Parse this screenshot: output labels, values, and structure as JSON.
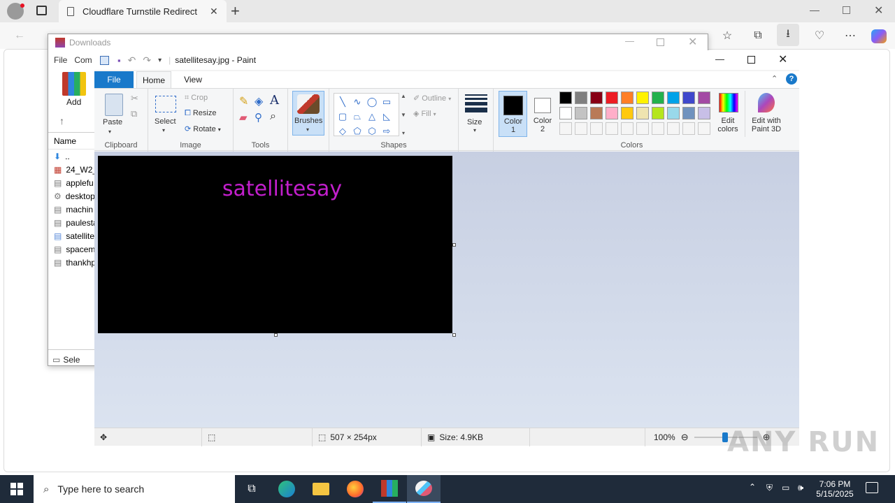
{
  "browser": {
    "tab_title": "Cloudflare Turnstile Redirect",
    "new_tab_label": "+"
  },
  "explorer": {
    "title": "Downloads",
    "menu": [
      "File",
      "Com"
    ],
    "add_label": "Add",
    "column_name": "Name",
    "files": [
      "..",
      "24_W2_I",
      "applefu",
      "desktop",
      "machin",
      "paulesta",
      "satellite",
      "spacem",
      "thankhp"
    ],
    "status": "Sele"
  },
  "paint": {
    "title": "satellitesay.jpg - Paint",
    "tabs": {
      "file": "File",
      "home": "Home",
      "view": "View"
    },
    "clipboard": {
      "paste": "Paste",
      "group": "Clipboard"
    },
    "image": {
      "select": "Select",
      "crop": "Crop",
      "resize": "Resize",
      "rotate": "Rotate",
      "group": "Image"
    },
    "tools": {
      "group": "Tools"
    },
    "brushes": {
      "label": "Brushes"
    },
    "shapes": {
      "outline": "Outline",
      "fill": "Fill",
      "group": "Shapes"
    },
    "size": {
      "label": "Size"
    },
    "colors": {
      "color1": "Color 1",
      "color2": "Color 2",
      "edit_colors": "Edit colors",
      "edit_paint3d": "Edit with Paint 3D",
      "group": "Colors",
      "color1_value": "#000000",
      "color2_value": "#ffffff",
      "palette": [
        "#000000",
        "#7f7f7f",
        "#880015",
        "#ed1c24",
        "#ff7f27",
        "#fff200",
        "#22b14c",
        "#00a2e8",
        "#3f48cc",
        "#a349a4",
        "#ffffff",
        "#c3c3c3",
        "#b97a57",
        "#ffaec9",
        "#ffc90e",
        "#efe4b0",
        "#b5e61d",
        "#99d9ea",
        "#7092be",
        "#c8bfe7",
        "#f5f5f5",
        "#f5f5f5",
        "#f5f5f5",
        "#f5f5f5",
        "#f5f5f5",
        "#f5f5f5",
        "#f5f5f5",
        "#f5f5f5",
        "#f5f5f5",
        "#f5f5f5"
      ]
    },
    "canvas_text": "satellitesay",
    "canvas_text_color": "#c21fcc",
    "status": {
      "dimensions": "507 × 254px",
      "size": "Size: 4.9KB",
      "zoom": "100%"
    }
  },
  "taskbar": {
    "search_placeholder": "Type here to search",
    "time": "7:06 PM",
    "date": "5/15/2025"
  },
  "watermark": "ANY RUN"
}
